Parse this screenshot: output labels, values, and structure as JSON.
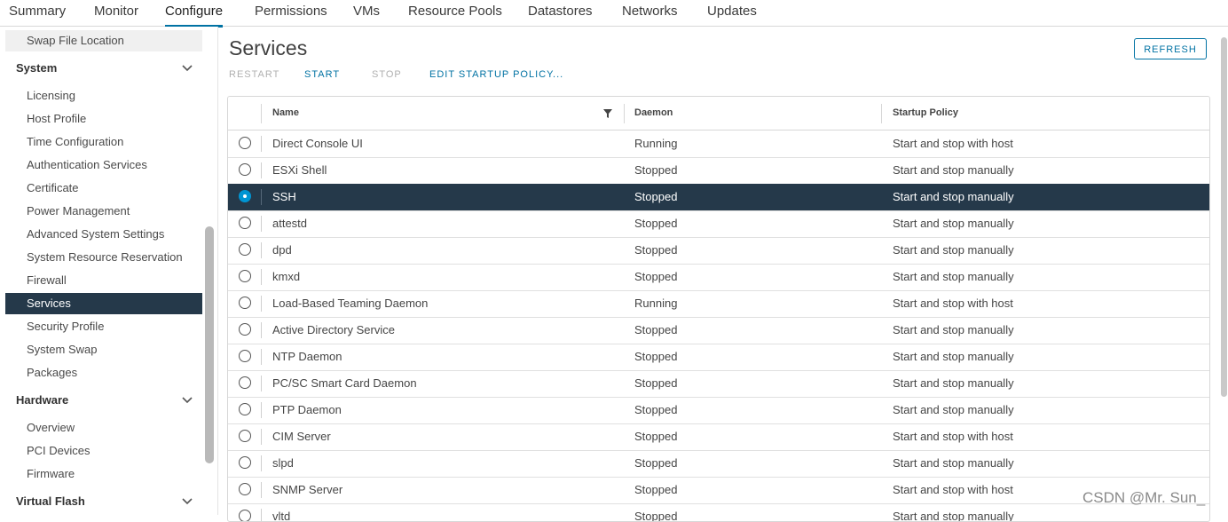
{
  "tabs": [
    {
      "label": "Summary",
      "active": false
    },
    {
      "label": "Monitor",
      "active": false
    },
    {
      "label": "Configure",
      "active": true
    },
    {
      "label": "Permissions",
      "active": false
    },
    {
      "label": "VMs",
      "active": false
    },
    {
      "label": "Resource Pools",
      "active": false
    },
    {
      "label": "Datastores",
      "active": false
    },
    {
      "label": "Networks",
      "active": false
    },
    {
      "label": "Updates",
      "active": false
    }
  ],
  "sidebar": {
    "top_item": "Swap File Location",
    "system": {
      "title": "System",
      "items": [
        "Licensing",
        "Host Profile",
        "Time Configuration",
        "Authentication Services",
        "Certificate",
        "Power Management",
        "Advanced System Settings",
        "System Resource Reservation",
        "Firewall",
        "Services",
        "Security Profile",
        "System Swap",
        "Packages"
      ],
      "active": "Services"
    },
    "hardware": {
      "title": "Hardware",
      "items": [
        "Overview",
        "PCI Devices",
        "Firmware"
      ]
    },
    "virtual_flash": {
      "title": "Virtual Flash"
    }
  },
  "main": {
    "title": "Services",
    "refresh_label": "REFRESH",
    "actions": {
      "restart": "RESTART",
      "start": "START",
      "stop": "STOP",
      "edit_policy": "EDIT STARTUP POLICY..."
    },
    "columns": {
      "name": "Name",
      "daemon": "Daemon",
      "startup_policy": "Startup Policy"
    },
    "rows": [
      {
        "name": "Direct Console UI",
        "daemon": "Running",
        "policy": "Start and stop with host",
        "selected": false
      },
      {
        "name": "ESXi Shell",
        "daemon": "Stopped",
        "policy": "Start and stop manually",
        "selected": false
      },
      {
        "name": "SSH",
        "daemon": "Stopped",
        "policy": "Start and stop manually",
        "selected": true
      },
      {
        "name": "attestd",
        "daemon": "Stopped",
        "policy": "Start and stop manually",
        "selected": false
      },
      {
        "name": "dpd",
        "daemon": "Stopped",
        "policy": "Start and stop manually",
        "selected": false
      },
      {
        "name": "kmxd",
        "daemon": "Stopped",
        "policy": "Start and stop manually",
        "selected": false
      },
      {
        "name": "Load-Based Teaming Daemon",
        "daemon": "Running",
        "policy": "Start and stop with host",
        "selected": false
      },
      {
        "name": "Active Directory Service",
        "daemon": "Stopped",
        "policy": "Start and stop manually",
        "selected": false
      },
      {
        "name": "NTP Daemon",
        "daemon": "Stopped",
        "policy": "Start and stop manually",
        "selected": false
      },
      {
        "name": "PC/SC Smart Card Daemon",
        "daemon": "Stopped",
        "policy": "Start and stop manually",
        "selected": false
      },
      {
        "name": "PTP Daemon",
        "daemon": "Stopped",
        "policy": "Start and stop manually",
        "selected": false
      },
      {
        "name": "CIM Server",
        "daemon": "Stopped",
        "policy": "Start and stop with host",
        "selected": false
      },
      {
        "name": "slpd",
        "daemon": "Stopped",
        "policy": "Start and stop manually",
        "selected": false
      },
      {
        "name": "SNMP Server",
        "daemon": "Stopped",
        "policy": "Start and stop with host",
        "selected": false
      },
      {
        "name": "vltd",
        "daemon": "Stopped",
        "policy": "Start and stop manually",
        "selected": false
      }
    ]
  },
  "watermark": "CSDN @Mr. Sun_",
  "colors": {
    "accent": "#0072a3",
    "selected_bg": "#25394a",
    "radio_selected": "#0095d3"
  },
  "icons": {
    "filter": "filter-icon",
    "chevron": "chevron-down-icon",
    "radio": "radio-button"
  }
}
